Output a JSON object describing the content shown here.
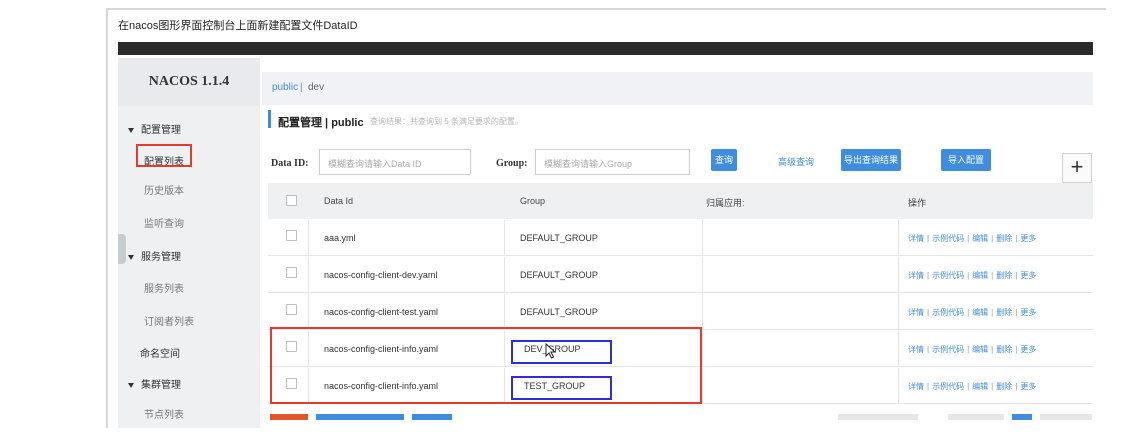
{
  "caption": "在nacos图形界面控制台上面新建配置文件DataID",
  "brand": "NACOS 1.1.4",
  "sidebar": {
    "groups": [
      {
        "label": "配置管理",
        "items": [
          "配置列表",
          "历史版本",
          "监听查询"
        ]
      },
      {
        "label": "服务管理",
        "items": [
          "服务列表",
          "订阅者列表"
        ]
      },
      {
        "label": "命名空间"
      },
      {
        "label": "集群管理",
        "items": [
          "节点列表"
        ]
      }
    ]
  },
  "breadcrumb": {
    "namespace": "public",
    "separator": "|",
    "other": "dev"
  },
  "page": {
    "title": "配置管理 | public",
    "summary": "查询结果：共查询到 5 条满足要求的配置。"
  },
  "search": {
    "dataid_label": "Data ID:",
    "dataid_placeholder": "模糊查询请输入Data ID",
    "group_label": "Group:",
    "group_placeholder": "模糊查询请输入Group",
    "query_btn": "查询",
    "advanced_link": "高级查询",
    "export_btn": "导出查询结果",
    "import_btn": "导入配置",
    "add_btn": "+"
  },
  "table": {
    "columns": [
      "Data Id",
      "Group",
      "归属应用:",
      "操作"
    ],
    "rows": [
      {
        "data_id": "aaa.yml",
        "group": "DEFAULT_GROUP",
        "app": ""
      },
      {
        "data_id": "nacos-config-client-dev.yaml",
        "group": "DEFAULT_GROUP",
        "app": ""
      },
      {
        "data_id": "nacos-config-client-test.yaml",
        "group": "DEFAULT_GROUP",
        "app": ""
      },
      {
        "data_id": "nacos-config-client-info.yaml",
        "group": "DEV_GROUP",
        "app": ""
      },
      {
        "data_id": "nacos-config-client-info.yaml",
        "group": "TEST_GROUP",
        "app": ""
      }
    ],
    "ops": [
      "详情",
      "示例代码",
      "编辑",
      "删除",
      "更多"
    ]
  },
  "colors": {
    "accent": "#3f8ddf",
    "highlight_red": "#e23b2f",
    "highlight_blue": "#2c2fd6",
    "topbar": "#2b2b2b"
  }
}
